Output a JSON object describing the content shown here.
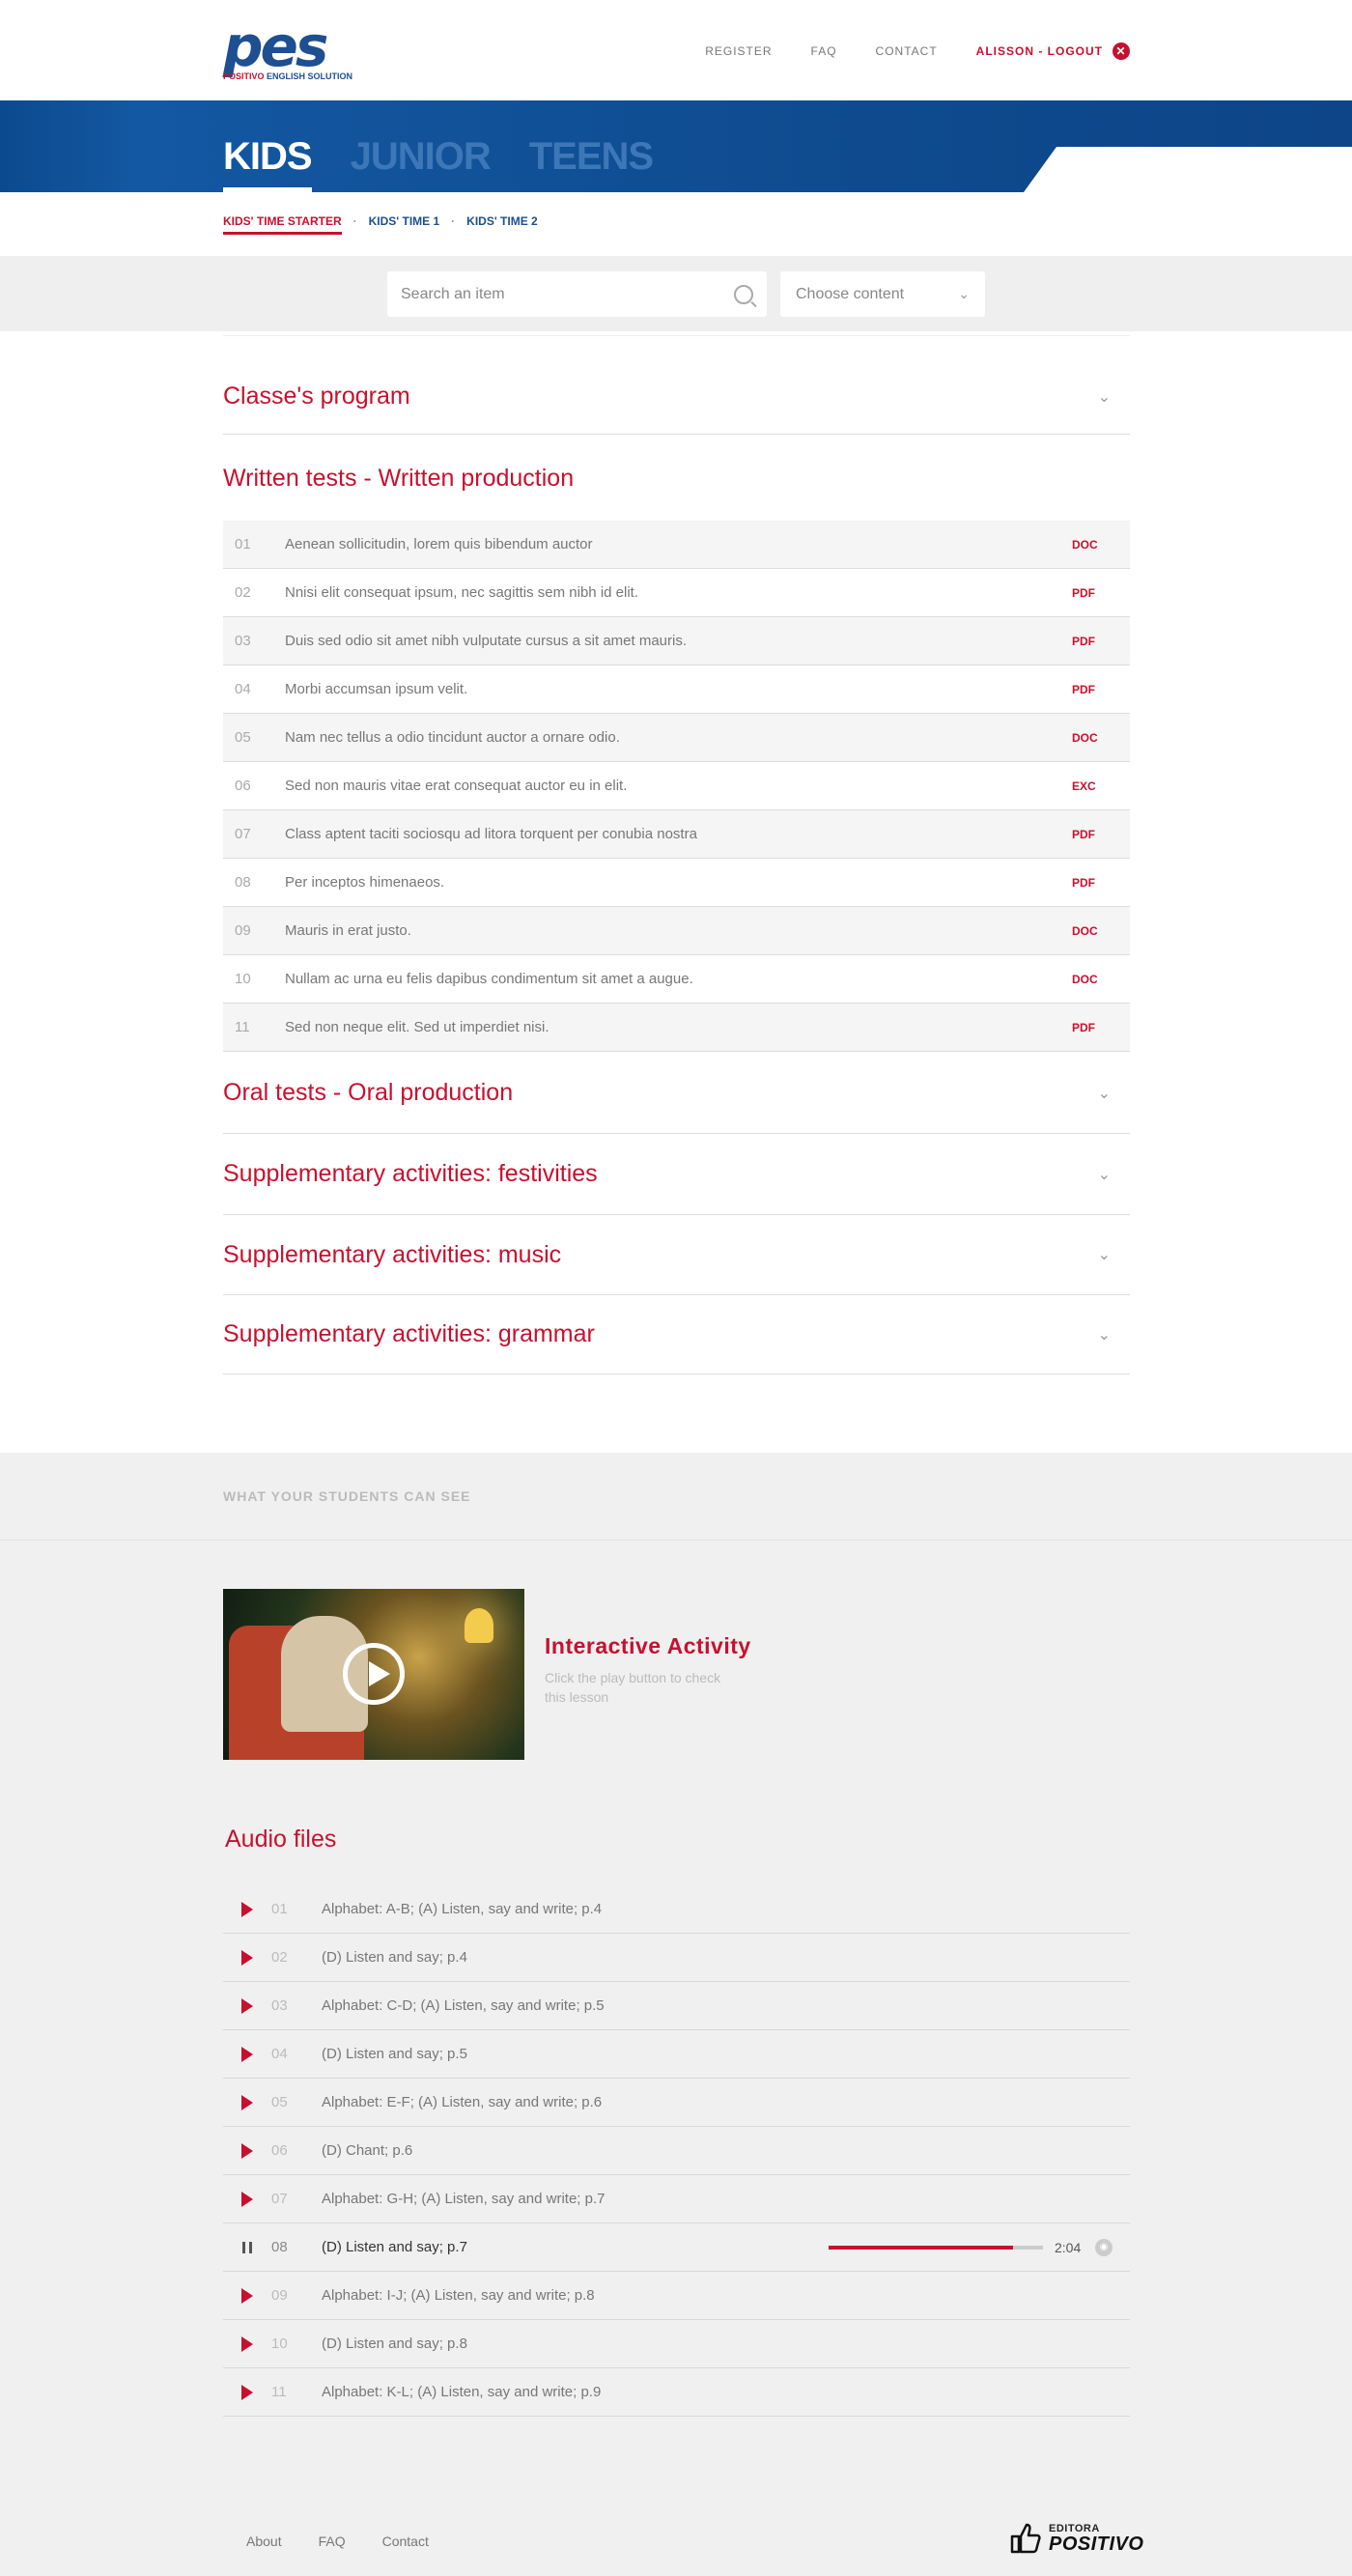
{
  "header": {
    "logo_big": "pes",
    "logo_small_red": "POSITIVO",
    "logo_small_blue": "ENGLISH SOLUTION",
    "nav": [
      "REGISTER",
      "FAQ",
      "CONTACT"
    ],
    "logout_label": "ALISSON - LOGOUT"
  },
  "levels": [
    "KIDS",
    "JUNIOR",
    "TEENS"
  ],
  "subtabs": [
    "KIDS' TIME STARTER",
    "KIDS' TIME 1",
    "KIDS' TIME 2"
  ],
  "search": {
    "placeholder": "Search an item",
    "select_value": "Choose content"
  },
  "sections": {
    "classes_program": "Classe's program",
    "written_tests": "Written tests - Written production",
    "oral_tests": "Oral tests - Oral production",
    "festivities": "Supplementary activities: festivities",
    "music": "Supplementary activities: music",
    "grammar": "Supplementary activities: grammar"
  },
  "documents": [
    {
      "num": "01",
      "title": "Aenean sollicitudin, lorem quis bibendum auctor",
      "type": "DOC"
    },
    {
      "num": "02",
      "title": "Nnisi elit consequat ipsum, nec sagittis sem nibh id elit.",
      "type": "PDF"
    },
    {
      "num": "03",
      "title": "Duis sed odio sit amet nibh vulputate cursus a sit amet mauris.",
      "type": "PDF"
    },
    {
      "num": "04",
      "title": "Morbi accumsan ipsum velit.",
      "type": "PDF"
    },
    {
      "num": "05",
      "title": "Nam nec tellus a odio tincidunt auctor a ornare odio.",
      "type": "DOC"
    },
    {
      "num": "06",
      "title": "Sed non  mauris vitae erat consequat auctor eu in elit.",
      "type": "EXC"
    },
    {
      "num": "07",
      "title": "Class aptent taciti sociosqu ad litora torquent per conubia nostra",
      "type": "PDF"
    },
    {
      "num": "08",
      "title": "Per inceptos himenaeos.",
      "type": "PDF"
    },
    {
      "num": "09",
      "title": "Mauris in erat justo.",
      "type": "DOC"
    },
    {
      "num": "10",
      "title": "Nullam ac urna eu felis dapibus condimentum sit amet a augue.",
      "type": "DOC"
    },
    {
      "num": "11",
      "title": "Sed non neque elit. Sed ut imperdiet nisi.",
      "type": "PDF"
    }
  ],
  "students": {
    "label": "WHAT YOUR STUDENTS CAN SEE",
    "activity_title": "Interactive Activity",
    "activity_text": "Click the play button to check this lesson"
  },
  "audio": {
    "title": "Audio files",
    "playing_index": 7,
    "progress_fraction": 0.86,
    "time": "2:04",
    "items": [
      {
        "num": "01",
        "title": "Alphabet: A-B; (A) Listen, say and write; p.4"
      },
      {
        "num": "02",
        "title": "(D) Listen and say; p.4"
      },
      {
        "num": "03",
        "title": "Alphabet: C-D; (A) Listen, say and write; p.5"
      },
      {
        "num": "04",
        "title": "(D) Listen and say; p.5"
      },
      {
        "num": "05",
        "title": "Alphabet: E-F; (A) Listen, say and write; p.6"
      },
      {
        "num": "06",
        "title": "(D) Chant; p.6"
      },
      {
        "num": "07",
        "title": "Alphabet: G-H; (A) Listen, say and write; p.7"
      },
      {
        "num": "08",
        "title": "(D) Listen and say; p.7"
      },
      {
        "num": "09",
        "title": "Alphabet: I-J; (A) Listen, say and write; p.8"
      },
      {
        "num": "10",
        "title": "(D) Listen and say; p.8"
      },
      {
        "num": "11",
        "title": "Alphabet: K-L; (A) Listen, say and write; p.9"
      }
    ]
  },
  "footer": {
    "links": [
      "About",
      "FAQ",
      "Contact"
    ],
    "logo_small": "EDITORA",
    "logo_big": "POSITIVO"
  },
  "colors": {
    "brand_blue": "#1d4f91",
    "accent_red": "#c8102e"
  },
  "icons": {
    "logout": "close-circle-icon",
    "search": "search-icon",
    "select": "chevron-down-icon",
    "play": "play-icon",
    "pause": "pause-icon",
    "volume": "volume-icon"
  }
}
